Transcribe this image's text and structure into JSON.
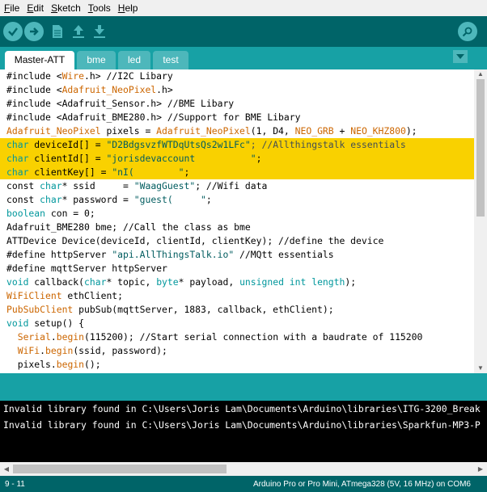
{
  "menu": {
    "items": [
      {
        "accel": "F",
        "rest": "ile"
      },
      {
        "accel": "E",
        "rest": "dit"
      },
      {
        "accel": "S",
        "rest": "ketch"
      },
      {
        "accel": "T",
        "rest": "ools"
      },
      {
        "accel": "H",
        "rest": "elp"
      }
    ]
  },
  "toolbar": {
    "buttons": [
      "verify-icon",
      "upload-icon",
      "new-icon",
      "open-icon",
      "save-icon"
    ],
    "serial_monitor": "serial-monitor-icon"
  },
  "tabs": [
    {
      "label": "Master-ATT",
      "active": true
    },
    {
      "label": "bme",
      "active": false
    },
    {
      "label": "led",
      "active": false
    },
    {
      "label": "test",
      "active": false
    }
  ],
  "editor": {
    "lines": [
      [
        {
          "t": "#include <",
          "c": "plain"
        },
        {
          "t": "Wire",
          "c": "kw"
        },
        {
          "t": ".h> //I2C Libary",
          "c": "plain"
        }
      ],
      [
        {
          "t": "#include <",
          "c": "plain"
        },
        {
          "t": "Adafruit_NeoPixel",
          "c": "kw"
        },
        {
          "t": ".h>",
          "c": "plain"
        }
      ],
      [
        {
          "t": "#include <Adafruit_Sensor.h> //BME Libary",
          "c": "plain"
        }
      ],
      [
        {
          "t": "#include <Adafruit_BME280.h> //Support for BME Libary",
          "c": "plain"
        }
      ],
      [
        {
          "t": "Adafruit_NeoPixel",
          "c": "kw"
        },
        {
          "t": " pixels = ",
          "c": "plain"
        },
        {
          "t": "Adafruit_NeoPixel",
          "c": "kw"
        },
        {
          "t": "(1, D4, ",
          "c": "plain"
        },
        {
          "t": "NEO_GRB",
          "c": "kw"
        },
        {
          "t": " + ",
          "c": "plain"
        },
        {
          "t": "NEO_KHZ800",
          "c": "kw"
        },
        {
          "t": ");",
          "c": "plain"
        }
      ],
      [
        {
          "t": "char",
          "c": "ty"
        },
        {
          "t": " deviceId[] = ",
          "c": "plain"
        },
        {
          "t": "\"D2BdgsvzfWTDqUtsQs2w1LFc\"",
          "c": "str"
        },
        {
          "t": "; //Allthingstalk essentials",
          "c": "cm"
        }
      ],
      [
        {
          "t": "char",
          "c": "ty"
        },
        {
          "t": " clientId[] = ",
          "c": "plain"
        },
        {
          "t": "\"jorisdevaccount          \"",
          "c": "str"
        },
        {
          "t": ";",
          "c": "plain"
        }
      ],
      [
        {
          "t": "char",
          "c": "ty"
        },
        {
          "t": " clientKey[] = ",
          "c": "plain"
        },
        {
          "t": "\"nI(        \"",
          "c": "str"
        },
        {
          "t": ";",
          "c": "plain"
        }
      ],
      [
        {
          "t": "const ",
          "c": "plain"
        },
        {
          "t": "char",
          "c": "ty"
        },
        {
          "t": "* ssid     = ",
          "c": "plain"
        },
        {
          "t": "\"WaagGuest\"",
          "c": "str"
        },
        {
          "t": "; //Wifi data",
          "c": "plain"
        }
      ],
      [
        {
          "t": "const ",
          "c": "plain"
        },
        {
          "t": "char",
          "c": "ty"
        },
        {
          "t": "* password = ",
          "c": "plain"
        },
        {
          "t": "\"guest(     \"",
          "c": "str"
        },
        {
          "t": ";",
          "c": "plain"
        }
      ],
      [
        {
          "t": "boolean",
          "c": "ty"
        },
        {
          "t": " con = 0;",
          "c": "plain"
        }
      ],
      [
        {
          "t": "Adafruit_BME280 bme; //Call the class as bme",
          "c": "plain"
        }
      ],
      [
        {
          "t": "ATTDevice Device(deviceId, clientId, clientKey); //define the device",
          "c": "plain"
        }
      ],
      [
        {
          "t": "#define httpServer ",
          "c": "plain"
        },
        {
          "t": "\"api.AllThingsTalk.io\"",
          "c": "str"
        },
        {
          "t": " //MQtt essentials",
          "c": "plain"
        }
      ],
      [
        {
          "t": "#define mqttServer httpServer",
          "c": "plain"
        }
      ],
      [
        {
          "t": "void",
          "c": "ty"
        },
        {
          "t": " callback(",
          "c": "plain"
        },
        {
          "t": "char",
          "c": "ty"
        },
        {
          "t": "* topic, ",
          "c": "plain"
        },
        {
          "t": "byte",
          "c": "ty"
        },
        {
          "t": "* payload, ",
          "c": "plain"
        },
        {
          "t": "unsigned int",
          "c": "ty"
        },
        {
          "t": " ",
          "c": "plain"
        },
        {
          "t": "length",
          "c": "ty"
        },
        {
          "t": ");",
          "c": "plain"
        }
      ],
      [
        {
          "t": "WiFiClient",
          "c": "kw"
        },
        {
          "t": " ethClient;",
          "c": "plain"
        }
      ],
      [
        {
          "t": "PubSubClient",
          "c": "kw"
        },
        {
          "t": " pubSub(mqttServer, 1883, callback, ethClient);",
          "c": "plain"
        }
      ],
      [
        {
          "t": "void",
          "c": "ty"
        },
        {
          "t": " setup() {",
          "c": "plain"
        }
      ],
      [
        {
          "t": "  ",
          "c": "plain"
        },
        {
          "t": "Serial",
          "c": "kw"
        },
        {
          "t": ".",
          "c": "plain"
        },
        {
          "t": "begin",
          "c": "kw"
        },
        {
          "t": "(115200); //Start serial connection with a baudrate of 115200",
          "c": "plain"
        }
      ],
      [
        {
          "t": "  ",
          "c": "plain"
        },
        {
          "t": "WiFi",
          "c": "kw"
        },
        {
          "t": ".",
          "c": "plain"
        },
        {
          "t": "begin",
          "c": "kw"
        },
        {
          "t": "(ssid, password);",
          "c": "plain"
        }
      ],
      [
        {
          "t": "  pixels.",
          "c": "plain"
        },
        {
          "t": "begin",
          "c": "kw"
        },
        {
          "t": "();",
          "c": "plain"
        }
      ]
    ],
    "highlighted_lines": [
      5,
      6,
      7
    ]
  },
  "console": {
    "lines": [
      "Invalid library found in C:\\Users\\Joris Lam\\Documents\\Arduino\\libraries\\ITG-3200_Break",
      "Invalid library found in C:\\Users\\Joris Lam\\Documents\\Arduino\\libraries\\Sparkfun-MP3-P"
    ]
  },
  "status": {
    "cursor": "9 - 11",
    "board": "Arduino Pro or Pro Mini, ATmega328 (5V, 16 MHz) on COM6"
  }
}
